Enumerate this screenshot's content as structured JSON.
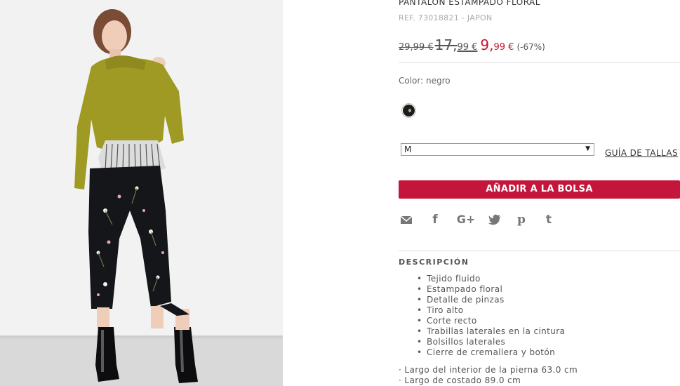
{
  "product": {
    "title": "PANTALÓN ESTAMPADO FLORAL",
    "ref": "REF. 73018821 - JAPON",
    "price_original": "29,99 €",
    "price_previous_int": "17,",
    "price_previous_dec": "99 €",
    "price_current_int": "9,",
    "price_current_dec": "99 €",
    "discount": "(-67%)"
  },
  "color": {
    "label": "Color: negro",
    "swatch_color": "#1b1b1b"
  },
  "size": {
    "selected": "M",
    "guide_label": "GUÍA DE TALLAS"
  },
  "cart": {
    "add_label": "AÑADIR A LA BOLSA",
    "button_color": "#c4153a"
  },
  "social": [
    "email-icon",
    "facebook-icon",
    "google-plus-icon",
    "twitter-icon",
    "pinterest-icon",
    "tumblr-icon"
  ],
  "description": {
    "title": "DESCRIPCIÓN",
    "items": [
      "Tejido fluido",
      "Estampado floral",
      "Detalle de pinzas",
      "Tiro alto",
      "Corte recto",
      "Trabillas laterales en la cintura",
      "Bolsillos laterales",
      "Cierre de cremallera y botón"
    ],
    "measures": [
      "· Largo del interior de la pierna 63.0 cm",
      "· Largo de costado 89.0 cm"
    ]
  }
}
